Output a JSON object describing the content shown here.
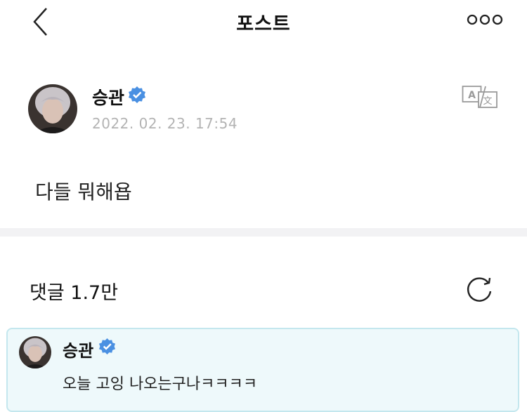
{
  "header": {
    "title": "포스트"
  },
  "post": {
    "author": "승관",
    "timestamp": "2022. 02. 23. 17:54",
    "content": "다들 뭐해욥"
  },
  "comments": {
    "title": "댓글 1.7만",
    "items": [
      {
        "author": "승관",
        "text": "오늘 고잉 나오는구나ㅋㅋㅋㅋ"
      }
    ]
  },
  "colors": {
    "verified": "#4a90e2",
    "comment_bg": "#eef9fb",
    "comment_border": "#c4e7ee"
  },
  "icons": [
    "back-icon",
    "more-icon",
    "verified-icon",
    "translate-icon",
    "refresh-icon"
  ]
}
